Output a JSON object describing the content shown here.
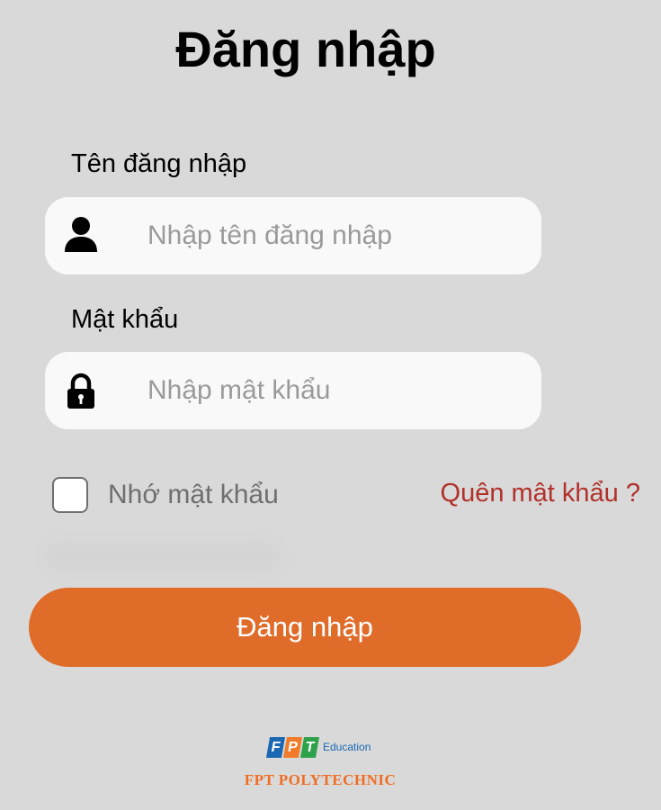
{
  "header": {
    "title": "Đăng nhập"
  },
  "form": {
    "username": {
      "label": "Tên đăng nhập",
      "placeholder": "Nhập tên đăng nhập",
      "value": "",
      "icon": "user-icon"
    },
    "password": {
      "label": "Mật khẩu",
      "placeholder": "Nhập mật khẩu",
      "value": "",
      "icon": "lock-icon"
    },
    "remember": {
      "label": "Nhớ mật khẩu",
      "checked": false
    },
    "forgot_link": "Quên mật khẩu ?",
    "submit_label": "Đăng nhập"
  },
  "footer": {
    "logo": {
      "letters": [
        "F",
        "P",
        "T"
      ],
      "sub": "Education"
    },
    "brand": "FPT POLYTECHNIC"
  },
  "colors": {
    "background": "#d9d9d9",
    "field": "#f9f9f9",
    "primary": "#e06c2a",
    "link": "#b1312b",
    "brand": "#f06d22"
  }
}
